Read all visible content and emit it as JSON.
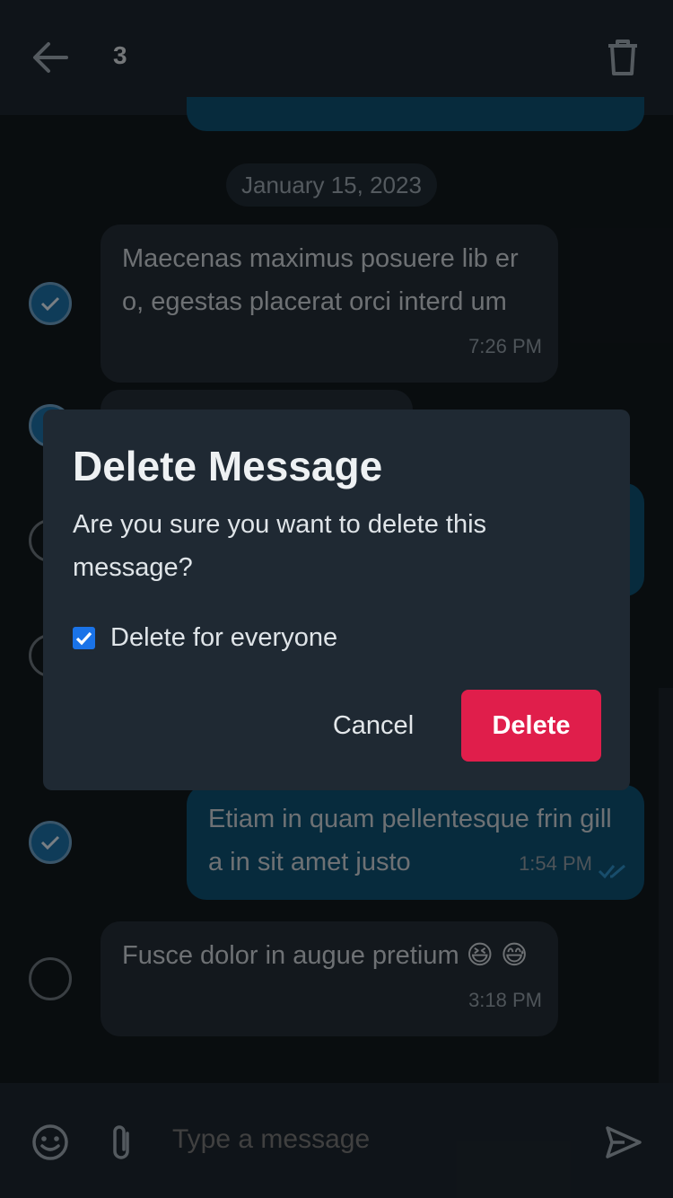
{
  "header": {
    "selected_count": "3",
    "back_icon": "arrow-left-icon",
    "trash_icon": "trash-icon"
  },
  "chat": {
    "date_separator": "January 15, 2023",
    "messages": [
      {
        "text": "Maecenas maximus posuere lib ero, egestas placerat orci interd um",
        "time": "7:26 PM",
        "direction": "incoming",
        "selected": true
      },
      {
        "text": "Etiam in quam pellentesque frin gilla in sit amet justo",
        "time": "1:54 PM",
        "direction": "outgoing",
        "selected": true
      },
      {
        "text": "Fusce dolor in augue pretium 😆 😅",
        "time": "3:18 PM",
        "direction": "incoming",
        "selected": false
      }
    ]
  },
  "input": {
    "placeholder": "Type a message",
    "emoji_icon": "smiley-icon",
    "attach_icon": "paperclip-icon",
    "send_icon": "send-icon"
  },
  "dialog": {
    "title": "Delete Message",
    "body": "Are you sure you want to delete this message?",
    "checkbox_label": "Delete for everyone",
    "checkbox_checked": true,
    "cancel_label": "Cancel",
    "delete_label": "Delete"
  },
  "colors": {
    "accent": "#1a73e8",
    "danger": "#e01e4b",
    "outgoing_bubble": "#0d4f70",
    "incoming_bubble": "#232c35"
  }
}
